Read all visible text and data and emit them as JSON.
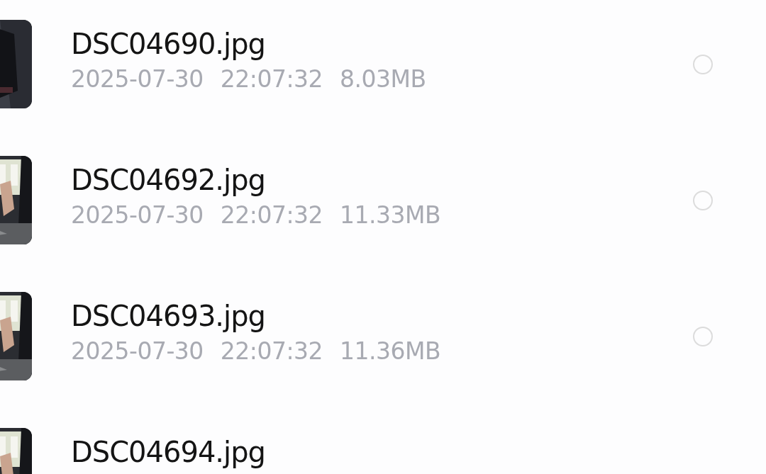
{
  "files": [
    {
      "name": "DSC04690.jpg",
      "date": "2025-07-30",
      "time": "22:07:32",
      "size": "8.03MB",
      "selected": false
    },
    {
      "name": "DSC04692.jpg",
      "date": "2025-07-30",
      "time": "22:07:32",
      "size": "11.33MB",
      "selected": false
    },
    {
      "name": "DSC04693.jpg",
      "date": "2025-07-30",
      "time": "22:07:32",
      "size": "11.36MB",
      "selected": false
    },
    {
      "name": "DSC04694.jpg"
    }
  ]
}
